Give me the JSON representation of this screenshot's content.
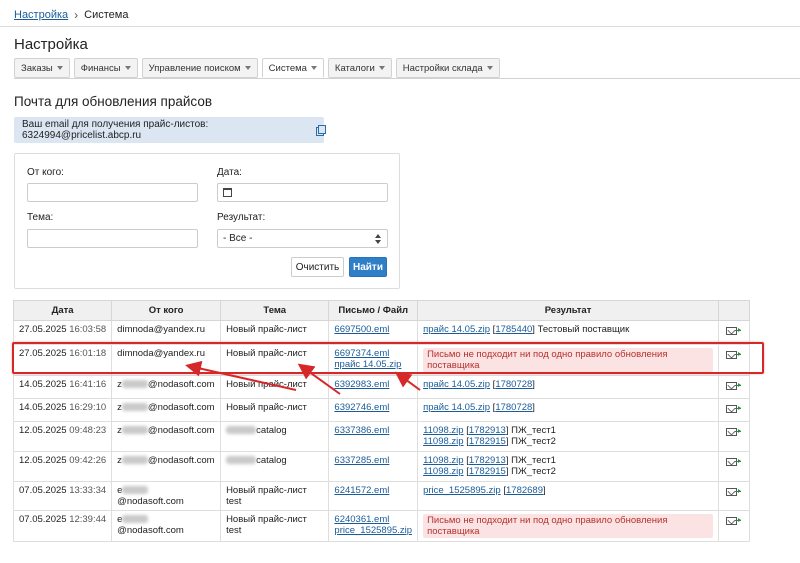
{
  "breadcrumb": {
    "root": "Настройка",
    "current": "Система"
  },
  "page_title": "Настройка",
  "tabs": [
    {
      "label": "Заказы",
      "active": false
    },
    {
      "label": "Финансы",
      "active": false
    },
    {
      "label": "Управление поиском",
      "active": false
    },
    {
      "label": "Система",
      "active": true
    },
    {
      "label": "Каталоги",
      "active": false
    },
    {
      "label": "Настройки склада",
      "active": false
    }
  ],
  "section_title": "Почта для обновления прайсов",
  "email_box": {
    "text": "Ваш email для получения прайс-листов: 6324994@pricelist.abcp.ru"
  },
  "filters": {
    "from_label": "От кого:",
    "from_value": "",
    "date_label": "Дата:",
    "date_value": "",
    "subject_label": "Тема:",
    "subject_value": "",
    "result_label": "Результат:",
    "result_selected": "- Все -",
    "clear_label": "Очистить",
    "find_label": "Найти"
  },
  "table": {
    "headers": [
      "Дата",
      "От кого",
      "Тема",
      "Письмо / Файл",
      "Результат",
      ""
    ],
    "rows": [
      {
        "date": "27.05.2025",
        "time": "16:03:58",
        "from": "dimnoda@yandex.ru",
        "subject": "Новый прайс-лист",
        "files": [
          "6697500.eml"
        ],
        "results": [
          {
            "file": "прайс 14.05.zip",
            "id": "1785440",
            "supplier": "Тестовый поставщик"
          }
        ],
        "error": ""
      },
      {
        "date": "27.05.2025",
        "time": "16:01:18",
        "from": "dimnoda@yandex.ru",
        "subject": "Новый прайс-лист",
        "files": [
          "6697374.eml",
          "прайс 14.05.zip"
        ],
        "results": [],
        "error": "Письмо не подходит ни под одно правило обновления поставщика"
      },
      {
        "date": "14.05.2025",
        "time": "16:41:16",
        "from_prefix": "z",
        "from_suffix": "@nodasoft.com",
        "subject": "Новый прайс-лист",
        "files": [
          "6392983.eml"
        ],
        "results": [
          {
            "file": "прайс 14.05.zip",
            "id": "1780728",
            "supplier": ""
          }
        ],
        "error": ""
      },
      {
        "date": "14.05.2025",
        "time": "16:29:10",
        "from_prefix": "z",
        "from_suffix": "@nodasoft.com",
        "subject": "Новый прайс-лист",
        "files": [
          "6392746.eml"
        ],
        "results": [
          {
            "file": "прайс 14.05.zip",
            "id": "1780728",
            "supplier": ""
          }
        ],
        "error": ""
      },
      {
        "date": "12.05.2025",
        "time": "09:48:23",
        "from_prefix": "z",
        "from_suffix": "@nodasoft.com",
        "subject_suffix": "catalog",
        "files": [
          "6337386.eml"
        ],
        "results": [
          {
            "file": "11098.zip",
            "id": "1782913",
            "supplier": "ПЖ_тест1"
          },
          {
            "file": "11098.zip",
            "id": "1782915",
            "supplier": "ПЖ_тест2"
          }
        ],
        "error": ""
      },
      {
        "date": "12.05.2025",
        "time": "09:42:26",
        "from_prefix": "z",
        "from_suffix": "@nodasoft.com",
        "subject_suffix": "catalog",
        "files": [
          "6337285.eml"
        ],
        "results": [
          {
            "file": "11098.zip",
            "id": "1782913",
            "supplier": "ПЖ_тест1"
          },
          {
            "file": "11098.zip",
            "id": "1782915",
            "supplier": "ПЖ_тест2"
          }
        ],
        "error": ""
      },
      {
        "date": "07.05.2025",
        "time": "13:33:34",
        "from_prefix": "e",
        "from_suffix": "@nodasoft.com",
        "subject": "Новый прайс-лист test",
        "files": [
          "6241572.eml"
        ],
        "results": [
          {
            "file": "price_1525895.zip",
            "id": "1782689",
            "supplier": ""
          }
        ],
        "error": ""
      },
      {
        "date": "07.05.2025",
        "time": "12:39:44",
        "from_prefix": "e",
        "from_suffix": "@nodasoft.com",
        "subject": "Новый прайс-лист test",
        "files": [
          "6240361.eml",
          "price_1525895.zip"
        ],
        "results": [],
        "error": "Письмо не подходит ни под одно правило обновления поставщика"
      }
    ]
  },
  "icons": {
    "copy": "copy-icon",
    "calendar": "calendar-icon",
    "resend": "mail-forward-icon"
  },
  "colors": {
    "link": "#1a5c9a",
    "accent": "#2f7ec8",
    "error_bg": "#fbe3e3",
    "error_text": "#b5322e",
    "highlight": "#d62828",
    "info_bg": "#dbe6f2"
  }
}
